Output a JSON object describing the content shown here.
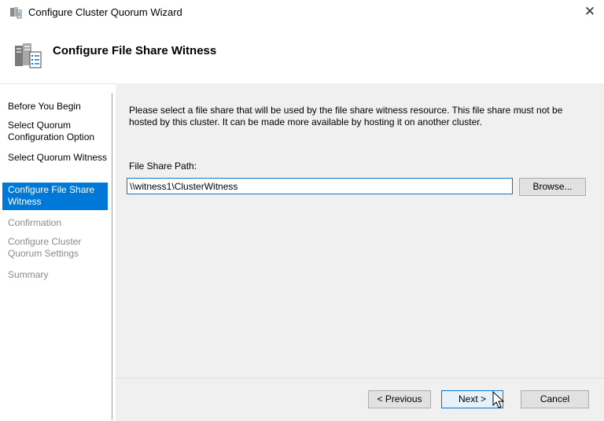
{
  "window": {
    "title": "Configure Cluster Quorum Wizard",
    "close_label": "✕"
  },
  "header": {
    "title": "Configure File Share Witness"
  },
  "nav": {
    "items": [
      {
        "label": "Before You Begin",
        "state": "normal"
      },
      {
        "label": "Select Quorum Configuration Option",
        "state": "normal"
      },
      {
        "label": "Select Quorum Witness",
        "state": "normal"
      },
      {
        "label": "Configure File Share Witness",
        "state": "active"
      },
      {
        "label": "Confirmation",
        "state": "disabled"
      },
      {
        "label": "Configure Cluster Quorum Settings",
        "state": "disabled"
      },
      {
        "label": "Summary",
        "state": "disabled"
      }
    ]
  },
  "main": {
    "description": "Please select a file share that will be used by the file share witness resource.  This file share must not be hosted by this cluster.  It can be made more available by hosting it on another cluster.",
    "file_share_label": "File Share Path:",
    "file_share_value": "\\\\witness1\\ClusterWitness",
    "browse_label": "Browse..."
  },
  "footer": {
    "previous_label": "< Previous",
    "next_label": "Next >",
    "cancel_label": "Cancel"
  },
  "colors": {
    "accent": "#0078d7",
    "content_bg": "#f0f0f0",
    "disabled_text": "#8a8a8a"
  }
}
